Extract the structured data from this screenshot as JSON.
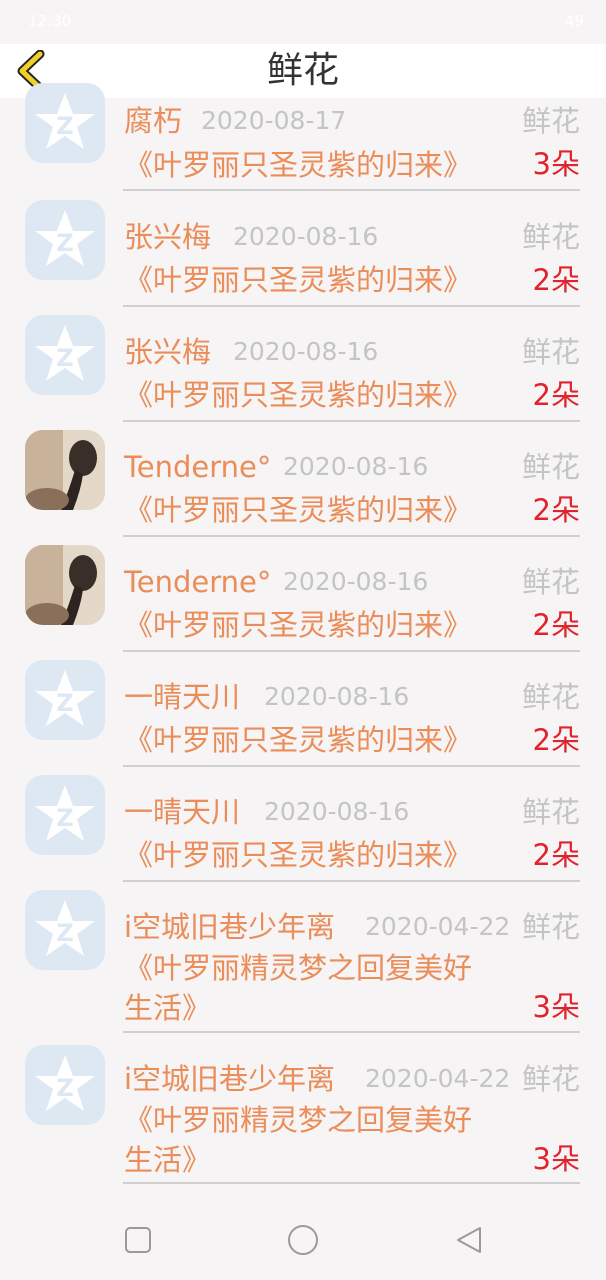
{
  "status": {
    "time": "12:30",
    "battery": "49"
  },
  "header": {
    "title": "鲜花",
    "back": "back-icon"
  },
  "rows": [
    {
      "user": "腐朽",
      "date": "2020-08-17",
      "type": "鲜花",
      "book": "《叶罗丽只圣灵紫的归来》",
      "count": "3朵",
      "avatar": "qq-star"
    },
    {
      "user": "张兴梅",
      "date": "2020-08-16",
      "type": "鲜花",
      "book": "《叶罗丽只圣灵紫的归来》",
      "count": "2朵",
      "avatar": "qq-star"
    },
    {
      "user": "张兴梅",
      "date": "2020-08-16",
      "type": "鲜花",
      "book": "《叶罗丽只圣灵紫的归来》",
      "count": "2朵",
      "avatar": "qq-star"
    },
    {
      "user": "Tenderne°",
      "date": "2020-08-16",
      "type": "鲜花",
      "book": "《叶罗丽只圣灵紫的归来》",
      "count": "2朵",
      "avatar": "photo"
    },
    {
      "user": "Tenderne°",
      "date": "2020-08-16",
      "type": "鲜花",
      "book": "《叶罗丽只圣灵紫的归来》",
      "count": "2朵",
      "avatar": "photo"
    },
    {
      "user": "一晴天川",
      "date": "2020-08-16",
      "type": "鲜花",
      "book": "《叶罗丽只圣灵紫的归来》",
      "count": "2朵",
      "avatar": "qq-star"
    },
    {
      "user": "一晴天川",
      "date": "2020-08-16",
      "type": "鲜花",
      "book": "《叶罗丽只圣灵紫的归来》",
      "count": "2朵",
      "avatar": "qq-star"
    },
    {
      "user": "i空城旧巷少年离",
      "date": "2020-04-22",
      "type": "鲜花",
      "book_line1": "《叶罗丽精灵梦之回复美好",
      "book_line2": "生活》",
      "count": "3朵",
      "avatar": "qq-star"
    },
    {
      "user": "i空城旧巷少年离",
      "date": "2020-04-22",
      "type": "鲜花",
      "book_line1": "《叶罗丽精灵梦之回复美好",
      "book_line2": "生活》",
      "count": "3朵",
      "avatar": "qq-star"
    }
  ],
  "nav": {
    "recents": "square-icon",
    "home": "circle-icon",
    "back": "triangle-back-icon"
  }
}
